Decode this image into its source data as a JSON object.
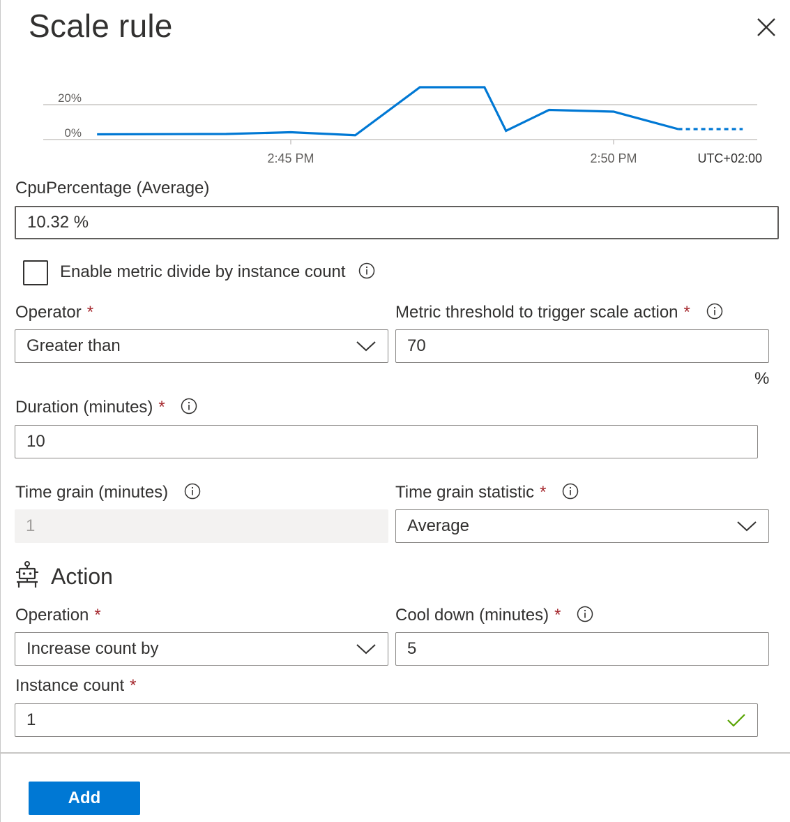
{
  "panel": {
    "title": "Scale rule",
    "close_icon": "close-icon"
  },
  "chart_data": {
    "type": "line",
    "yticks": [
      "0%",
      "20%"
    ],
    "xticks": [
      "2:45 PM",
      "2:50 PM"
    ],
    "timezone": "UTC+02:00",
    "series": [
      {
        "values": [
          {
            "x": "2:42 PM",
            "y": 3.0
          },
          {
            "x": "2:44 PM",
            "y": 3.2
          },
          {
            "x": "2:45 PM",
            "y": 4.2
          },
          {
            "x": "2:46 PM",
            "y": 2.5
          },
          {
            "x": "2:47 PM",
            "y": 30.0
          },
          {
            "x": "2:48 PM",
            "y": 30.0
          },
          {
            "x": "2:48:20 PM",
            "y": 5.0
          },
          {
            "x": "2:49 PM",
            "y": 17.0
          },
          {
            "x": "2:50 PM",
            "y": 16.0
          },
          {
            "x": "2:51 PM",
            "y": 6.0
          }
        ]
      },
      {
        "style": "dotted",
        "values": [
          {
            "x": "2:51 PM",
            "y": 6.0
          },
          {
            "x": "2:52 PM",
            "y": 6.0
          }
        ]
      }
    ],
    "color": "#0078d4",
    "ylim": [
      0,
      20
    ],
    "grid": true
  },
  "metric": {
    "label": "CpuPercentage (Average)",
    "value": "10.32 %"
  },
  "divide": {
    "label": "Enable metric divide by instance count",
    "checked": false
  },
  "operator": {
    "label": "Operator",
    "required": "*",
    "value": "Greater than"
  },
  "threshold": {
    "label": "Metric threshold to trigger scale action",
    "required": "*",
    "value": "70",
    "unit": "%"
  },
  "duration": {
    "label": "Duration (minutes)",
    "required": "*",
    "value": "10"
  },
  "time_grain": {
    "label": "Time grain (minutes)",
    "value": "1"
  },
  "time_grain_statistic": {
    "label": "Time grain statistic",
    "required": "*",
    "value": "Average"
  },
  "action": {
    "heading": "Action",
    "icon": "robot-icon"
  },
  "operation": {
    "label": "Operation",
    "required": "*",
    "value": "Increase count by"
  },
  "cooldown": {
    "label": "Cool down (minutes)",
    "required": "*",
    "value": "5"
  },
  "instance_count": {
    "label": "Instance count",
    "required": "*",
    "value": "1"
  },
  "footer": {
    "add_label": "Add"
  }
}
